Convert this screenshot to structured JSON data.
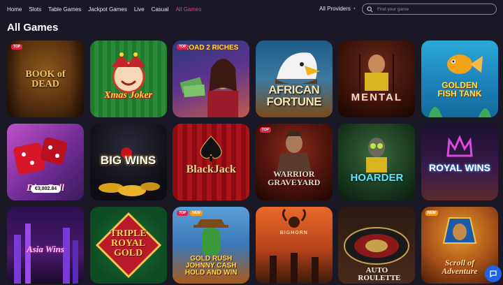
{
  "nav": {
    "items": [
      {
        "label": "Home",
        "active": false
      },
      {
        "label": "Slots",
        "active": false
      },
      {
        "label": "Table Games",
        "active": false
      },
      {
        "label": "Jackpot Games",
        "active": false
      },
      {
        "label": "Live",
        "active": false
      },
      {
        "label": "Casual",
        "active": false
      },
      {
        "label": "All Games",
        "active": true
      }
    ],
    "providers_label": "All Providers",
    "search_placeholder": "Find your game"
  },
  "page_title": "All Games",
  "games": [
    {
      "title_text": "BOOK of DEAD",
      "badges": [
        "TOP"
      ]
    },
    {
      "title_text": "Xmas Joker",
      "badges": []
    },
    {
      "title_text": "ROAD 2 RICHES",
      "badges": [
        "TOP"
      ]
    },
    {
      "title_text": "AFRICAN FORTUNE",
      "badges": []
    },
    {
      "title_text": "MENTAL",
      "badges": []
    },
    {
      "title_text": "GOLDEN FISH TANK",
      "badges": []
    },
    {
      "title_text": "Dice Roll",
      "badges": [],
      "jackpot": "€3,802.84"
    },
    {
      "title_text": "BIG WINS",
      "badges": []
    },
    {
      "title_text": "BlackJack",
      "badges": []
    },
    {
      "title_text": "WARRIOR GRAVEYARD",
      "badges": [
        "TOP"
      ]
    },
    {
      "title_text": "HOARDER",
      "badges": []
    },
    {
      "title_text": "ROYAL WINS",
      "badges": []
    },
    {
      "title_text": "Asia Wins",
      "badges": []
    },
    {
      "title_text": "TRIPLE ROYAL GOLD",
      "badges": []
    },
    {
      "title_text": "GOLD RUSH JOHNNY CASH HOLD AND WIN",
      "badges": [
        "TOP",
        "NEW"
      ]
    },
    {
      "title_text": "BIGHORN",
      "badges": []
    },
    {
      "title_text": "AUTO ROULETTE",
      "badges": []
    },
    {
      "title_text": "Scroll of Adventure",
      "badges": [
        "NEW"
      ]
    }
  ],
  "colors": {
    "background": "#1b1826",
    "accent": "#e2408e",
    "chat": "#1e64e6"
  },
  "icons": {
    "search": "search-icon",
    "chevron": "chevron-down-icon",
    "chat": "chat-icon"
  }
}
